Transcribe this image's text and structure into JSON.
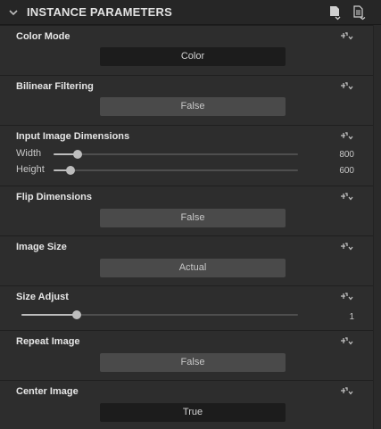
{
  "header": {
    "title": "INSTANCE PARAMETERS"
  },
  "sections": {
    "color_mode": {
      "label": "Color Mode",
      "value": "Color"
    },
    "bilinear": {
      "label": "Bilinear Filtering",
      "value": "False"
    },
    "input_dims": {
      "label": "Input Image Dimensions",
      "width": {
        "label": "Width",
        "value": "800",
        "fraction": 0.1
      },
      "height": {
        "label": "Height",
        "value": "600",
        "fraction": 0.07
      }
    },
    "flip": {
      "label": "Flip Dimensions",
      "value": "False"
    },
    "image_size": {
      "label": "Image Size",
      "value": "Actual"
    },
    "size_adjust": {
      "label": "Size Adjust",
      "value": "1",
      "fraction": 0.2
    },
    "repeat": {
      "label": "Repeat Image",
      "value": "False"
    },
    "center": {
      "label": "Center Image",
      "value": "True"
    }
  },
  "colors": {
    "panel": "#2d2d2d",
    "dropdown_dark": "#1c1c1c",
    "dropdown_light": "#4a4a4a"
  },
  "icons": [
    "chevron-down-icon",
    "document-icon",
    "list-document-icon",
    "link-icon"
  ]
}
